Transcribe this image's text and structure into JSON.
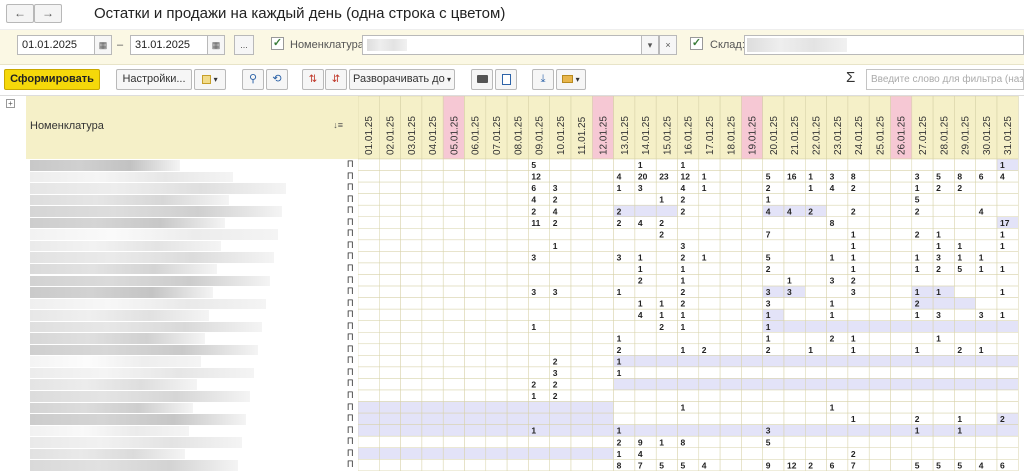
{
  "window": {
    "title": "Остатки и продажи на каждый день (одна строка с цветом)",
    "back_icon": "←",
    "forward_icon": "→"
  },
  "params": {
    "date_from": "01.01.2025",
    "date_to": "31.01.2025",
    "date_sep": "–",
    "period_button": "...",
    "nomenclature_label": "Номенклатура:",
    "warehouse_label": "Склад:",
    "check_mark": "✓",
    "calendar_icon": "▦",
    "dropdown_icon": "▾",
    "clear_icon": "×"
  },
  "toolbar": {
    "generate_label": "Сформировать",
    "settings_label": "Настройки...",
    "expand_label": "Разворачивать до",
    "sigma": "Σ",
    "filter_placeholder": "Введите слово для фильтра (назв"
  },
  "report": {
    "nom_header": "Номенклатура",
    "row_marker": "П",
    "expand_icon": "+",
    "sort_icon": "↓≡",
    "dates": [
      "01.01.25",
      "02.01.25",
      "03.01.25",
      "04.01.25",
      "05.01.25",
      "06.01.25",
      "07.01.25",
      "08.01.25",
      "09.01.25",
      "10.01.25",
      "11.01.25",
      "12.01.25",
      "13.01.25",
      "14.01.25",
      "15.01.25",
      "16.01.25",
      "17.01.25",
      "18.01.25",
      "19.01.25",
      "20.01.25",
      "21.01.25",
      "22.01.25",
      "23.01.25",
      "24.01.25",
      "25.01.25",
      "26.01.25",
      "27.01.25",
      "28.01.25",
      "29.01.25",
      "30.01.25",
      "31.01.25"
    ],
    "weekend_indices": [
      4,
      11,
      18,
      25
    ],
    "colors": {
      "header": "#f5f0c8",
      "weekend_header": "#f6c8d4",
      "shade": "#e3e3f8",
      "grid": "#d7d2a8",
      "white": "#ffffff"
    },
    "rows": [
      {
        "v": {
          "8": "5",
          "13": "1",
          "15": "1",
          "30": "1"
        },
        "s": [
          [
            30,
            31
          ]
        ]
      },
      {
        "v": {
          "8": "12",
          "12": "4",
          "13": "20",
          "14": "23",
          "15": "12",
          "16": "1",
          "19": "5",
          "20": "16",
          "21": "1",
          "22": "3",
          "23": "8",
          "26": "3",
          "27": "5",
          "28": "8",
          "29": "6",
          "30": "4"
        },
        "s": []
      },
      {
        "v": {
          "8": "6",
          "9": "3",
          "12": "1",
          "13": "3",
          "15": "4",
          "16": "1",
          "19": "2",
          "21": "1",
          "22": "4",
          "23": "2",
          "26": "1",
          "27": "2",
          "28": "2"
        },
        "s": []
      },
      {
        "v": {
          "8": "4",
          "9": "2",
          "14": "1",
          "15": "2",
          "19": "1",
          "26": "5"
        },
        "s": []
      },
      {
        "v": {
          "8": "2",
          "9": "4",
          "12": "2",
          "15": "2",
          "19": "4",
          "20": "4",
          "21": "2",
          "23": "2",
          "26": "2",
          "29": "4"
        },
        "s": [
          [
            12,
            15
          ],
          [
            19,
            22
          ]
        ]
      },
      {
        "v": {
          "8": "11",
          "9": "2",
          "12": "2",
          "13": "4",
          "14": "2",
          "22": "8",
          "30": "17"
        },
        "s": [
          [
            30,
            31
          ]
        ]
      },
      {
        "v": {
          "14": "2",
          "19": "7",
          "23": "1",
          "26": "2",
          "27": "1",
          "30": "1"
        },
        "s": []
      },
      {
        "v": {
          "9": "1",
          "15": "3",
          "23": "1",
          "27": "1",
          "28": "1",
          "30": "1"
        },
        "s": []
      },
      {
        "v": {
          "8": "3",
          "12": "3",
          "13": "1",
          "15": "2",
          "16": "1",
          "19": "5",
          "22": "1",
          "23": "1",
          "26": "1",
          "27": "3",
          "28": "1",
          "29": "1"
        },
        "s": []
      },
      {
        "v": {
          "13": "1",
          "15": "1",
          "19": "2",
          "23": "1",
          "26": "1",
          "27": "2",
          "28": "5",
          "29": "1",
          "30": "1"
        },
        "s": []
      },
      {
        "v": {
          "13": "2",
          "15": "1",
          "20": "1",
          "22": "3",
          "23": "2"
        },
        "s": []
      },
      {
        "v": {
          "8": "3",
          "9": "3",
          "12": "1",
          "15": "2",
          "19": "3",
          "20": "3",
          "23": "3",
          "26": "1",
          "27": "1",
          "30": "1"
        },
        "s": [
          [
            19,
            21
          ],
          [
            26,
            28
          ]
        ]
      },
      {
        "v": {
          "13": "1",
          "14": "1",
          "15": "2",
          "19": "3",
          "22": "1",
          "26": "2"
        },
        "s": [
          [
            26,
            29
          ]
        ]
      },
      {
        "v": {
          "13": "4",
          "14": "1",
          "15": "1",
          "19": "1",
          "22": "1",
          "26": "1",
          "27": "3",
          "29": "3",
          "30": "1"
        },
        "s": [
          [
            19,
            20
          ]
        ]
      },
      {
        "v": {
          "8": "1",
          "14": "2",
          "15": "1",
          "19": "1"
        },
        "s": [
          [
            19,
            31
          ]
        ]
      },
      {
        "v": {
          "12": "1",
          "19": "1",
          "22": "2",
          "23": "1",
          "27": "1"
        },
        "s": []
      },
      {
        "v": {
          "12": "2",
          "15": "1",
          "16": "2",
          "19": "2",
          "21": "1",
          "23": "1",
          "26": "1",
          "28": "2",
          "29": "1"
        },
        "s": []
      },
      {
        "v": {
          "9": "2",
          "12": "1"
        },
        "s": [
          [
            12,
            31
          ]
        ]
      },
      {
        "v": {
          "9": "3",
          "12": "1"
        },
        "s": []
      },
      {
        "v": {
          "8": "2",
          "9": "2"
        },
        "s": [
          [
            12,
            31
          ]
        ]
      },
      {
        "v": {
          "8": "1",
          "9": "2"
        },
        "s": []
      },
      {
        "v": {
          "15": "1",
          "22": "1"
        },
        "s": [
          [
            0,
            12
          ]
        ]
      },
      {
        "v": {
          "23": "1",
          "26": "2",
          "28": "1",
          "30": "2"
        },
        "s": [
          [
            0,
            12
          ],
          [
            30,
            31
          ]
        ]
      },
      {
        "v": {
          "8": "1",
          "12": "1",
          "19": "3",
          "26": "1",
          "28": "1"
        },
        "s": [
          [
            0,
            31
          ]
        ]
      },
      {
        "v": {
          "12": "2",
          "13": "9",
          "14": "1",
          "15": "8",
          "19": "5"
        },
        "s": []
      },
      {
        "v": {
          "12": "1",
          "13": "4",
          "23": "2"
        },
        "s": [
          [
            0,
            12
          ]
        ]
      },
      {
        "v": {
          "12": "8",
          "13": "7",
          "14": "5",
          "15": "5",
          "16": "4",
          "19": "9",
          "20": "12",
          "21": "2",
          "22": "6",
          "23": "7",
          "26": "5",
          "27": "5",
          "28": "5",
          "29": "4",
          "30": "6"
        },
        "s": []
      }
    ]
  }
}
